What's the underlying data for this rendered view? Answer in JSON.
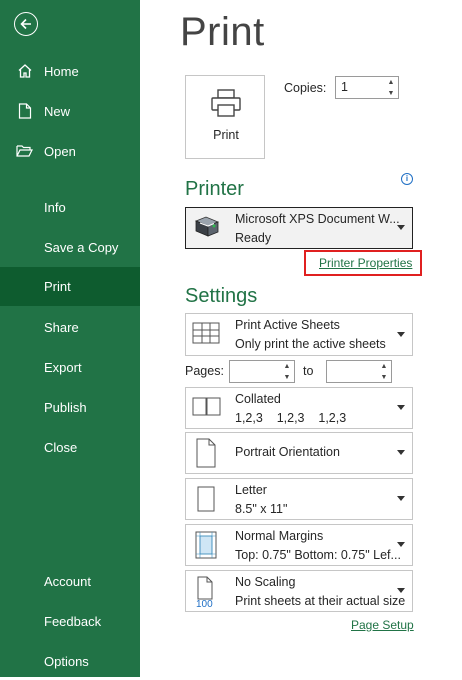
{
  "sidebar": {
    "items": [
      {
        "label": "Home",
        "icon": "home-icon"
      },
      {
        "label": "New",
        "icon": "new-document-icon"
      },
      {
        "label": "Open",
        "icon": "folder-open-icon"
      },
      {
        "label": "Info"
      },
      {
        "label": "Save a Copy"
      },
      {
        "label": "Print"
      },
      {
        "label": "Share"
      },
      {
        "label": "Export"
      },
      {
        "label": "Publish"
      },
      {
        "label": "Close"
      },
      {
        "label": "Account"
      },
      {
        "label": "Feedback"
      },
      {
        "label": "Options"
      }
    ],
    "active": "Print"
  },
  "main": {
    "title": "Print",
    "print_button_label": "Print",
    "copies_label": "Copies:",
    "copies_value": "1",
    "printer_heading": "Printer",
    "printer": {
      "name": "Microsoft XPS Document W...",
      "status": "Ready"
    },
    "printer_properties_link": "Printer Properties",
    "settings_heading": "Settings",
    "settings": {
      "sheets": {
        "line1": "Print Active Sheets",
        "line2": "Only print the active sheets"
      },
      "pages_label": "Pages:",
      "to_label": "to",
      "pages_from": "",
      "pages_to": "",
      "collation": {
        "line1": "Collated",
        "line2": "1,2,3    1,2,3    1,2,3"
      },
      "orientation": {
        "line1": "Portrait Orientation"
      },
      "paper": {
        "line1": "Letter",
        "line2": "8.5\" x 11\""
      },
      "margins": {
        "line1": "Normal Margins",
        "line2": "Top: 0.75\" Bottom: 0.75\" Lef..."
      },
      "scaling": {
        "line1": "No Scaling",
        "line2": "Print sheets at their actual size",
        "icon_text": "100"
      }
    },
    "page_setup_link": "Page Setup"
  },
  "colors": {
    "accent": "#217346",
    "sidebar_active": "#0e5c2f",
    "highlight": "#e02020"
  }
}
